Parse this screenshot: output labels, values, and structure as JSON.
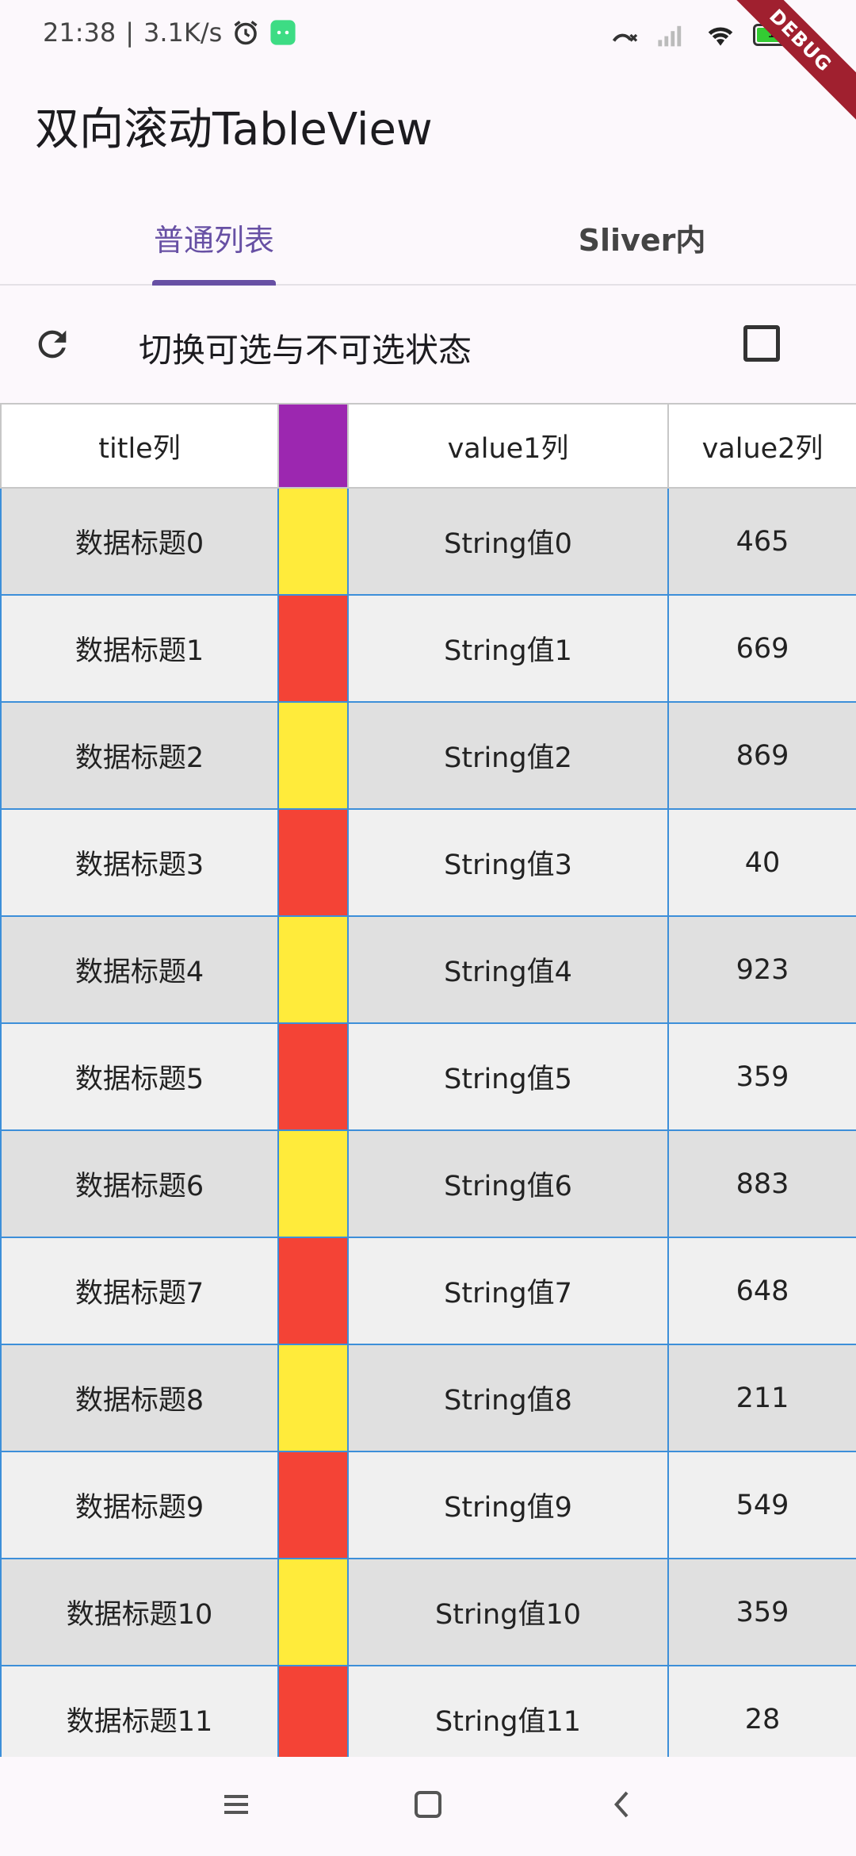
{
  "status": {
    "time": "21:38",
    "network_speed": "3.1K/s",
    "battery": "100",
    "debug_label": "DEBUG"
  },
  "app": {
    "title": "双向滚动TableView"
  },
  "tabs": [
    {
      "label": "普通列表",
      "active": true
    },
    {
      "label": "Sliver内",
      "active": false
    }
  ],
  "toolbar": {
    "toggle_label": "切换可选与不可选状态",
    "checkbox_checked": false
  },
  "table": {
    "headers": [
      "title列",
      "",
      "value1列",
      "value2列"
    ],
    "header_color": "#9c27b0",
    "row_colors": [
      "#e0e0e0",
      "#f0f0f0"
    ],
    "marker_colors": {
      "yellow": "#ffeb3b",
      "red": "#f44336"
    },
    "rows": [
      {
        "title": "数据标题0",
        "marker": "yellow",
        "value1": "String值0",
        "value2": "465"
      },
      {
        "title": "数据标题1",
        "marker": "red",
        "value1": "String值1",
        "value2": "669"
      },
      {
        "title": "数据标题2",
        "marker": "yellow",
        "value1": "String值2",
        "value2": "869"
      },
      {
        "title": "数据标题3",
        "marker": "red",
        "value1": "String值3",
        "value2": "40"
      },
      {
        "title": "数据标题4",
        "marker": "yellow",
        "value1": "String值4",
        "value2": "923"
      },
      {
        "title": "数据标题5",
        "marker": "red",
        "value1": "String值5",
        "value2": "359"
      },
      {
        "title": "数据标题6",
        "marker": "yellow",
        "value1": "String值6",
        "value2": "883"
      },
      {
        "title": "数据标题7",
        "marker": "red",
        "value1": "String值7",
        "value2": "648"
      },
      {
        "title": "数据标题8",
        "marker": "yellow",
        "value1": "String值8",
        "value2": "211"
      },
      {
        "title": "数据标题9",
        "marker": "red",
        "value1": "String值9",
        "value2": "549"
      },
      {
        "title": "数据标题10",
        "marker": "yellow",
        "value1": "String值10",
        "value2": "359"
      },
      {
        "title": "数据标题11",
        "marker": "red",
        "value1": "String值11",
        "value2": "28"
      }
    ]
  },
  "nav": {
    "menu_icon": "menu-icon",
    "home_icon": "home-icon",
    "back_icon": "back-icon"
  }
}
